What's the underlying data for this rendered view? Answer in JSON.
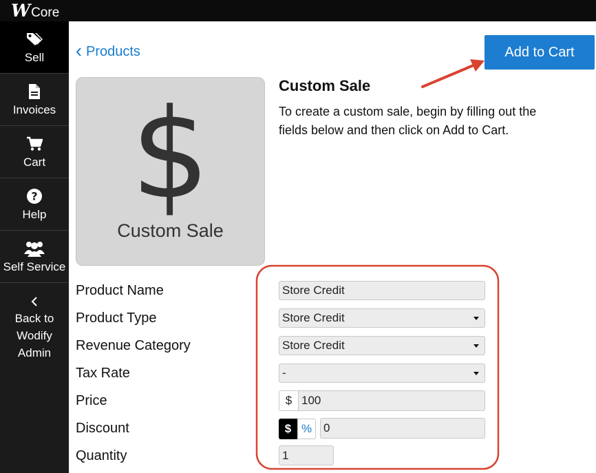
{
  "app": {
    "brand_mark": "W",
    "brand_name": "Core"
  },
  "sidebar": {
    "items": [
      {
        "label": "Sell",
        "icon": "tag-icon",
        "active": true
      },
      {
        "label": "Invoices",
        "icon": "document-icon"
      },
      {
        "label": "Cart",
        "icon": "cart-icon"
      },
      {
        "label": "Help",
        "icon": "question-icon"
      },
      {
        "label": "Self Service",
        "icon": "users-icon"
      }
    ],
    "back": {
      "lines": [
        "Back to",
        "Wodify",
        "Admin"
      ],
      "icon": "chevron-left-icon"
    }
  },
  "breadcrumb": {
    "label": "Products"
  },
  "actions": {
    "add_to_cart": "Add to Cart"
  },
  "product": {
    "symbol": "$",
    "card_label": "Custom Sale",
    "title": "Custom Sale",
    "description": "To create a custom sale, begin by filling out the fields below and then click on Add to Cart."
  },
  "form": {
    "product_name": {
      "label": "Product Name",
      "value": "Store Credit"
    },
    "product_type": {
      "label": "Product Type",
      "value": "Store Credit"
    },
    "revenue_category": {
      "label": "Revenue Category",
      "value": "Store Credit"
    },
    "tax_rate": {
      "label": "Tax Rate",
      "value": "-"
    },
    "price": {
      "label": "Price",
      "currency": "$",
      "value": "100"
    },
    "discount": {
      "label": "Discount",
      "dollar_label": "$",
      "percent_label": "%",
      "value": "0"
    },
    "quantity": {
      "label": "Quantity",
      "value": "1"
    }
  },
  "annotation_colors": {
    "highlight": "#d9432f",
    "accent": "#1d7dd0"
  }
}
